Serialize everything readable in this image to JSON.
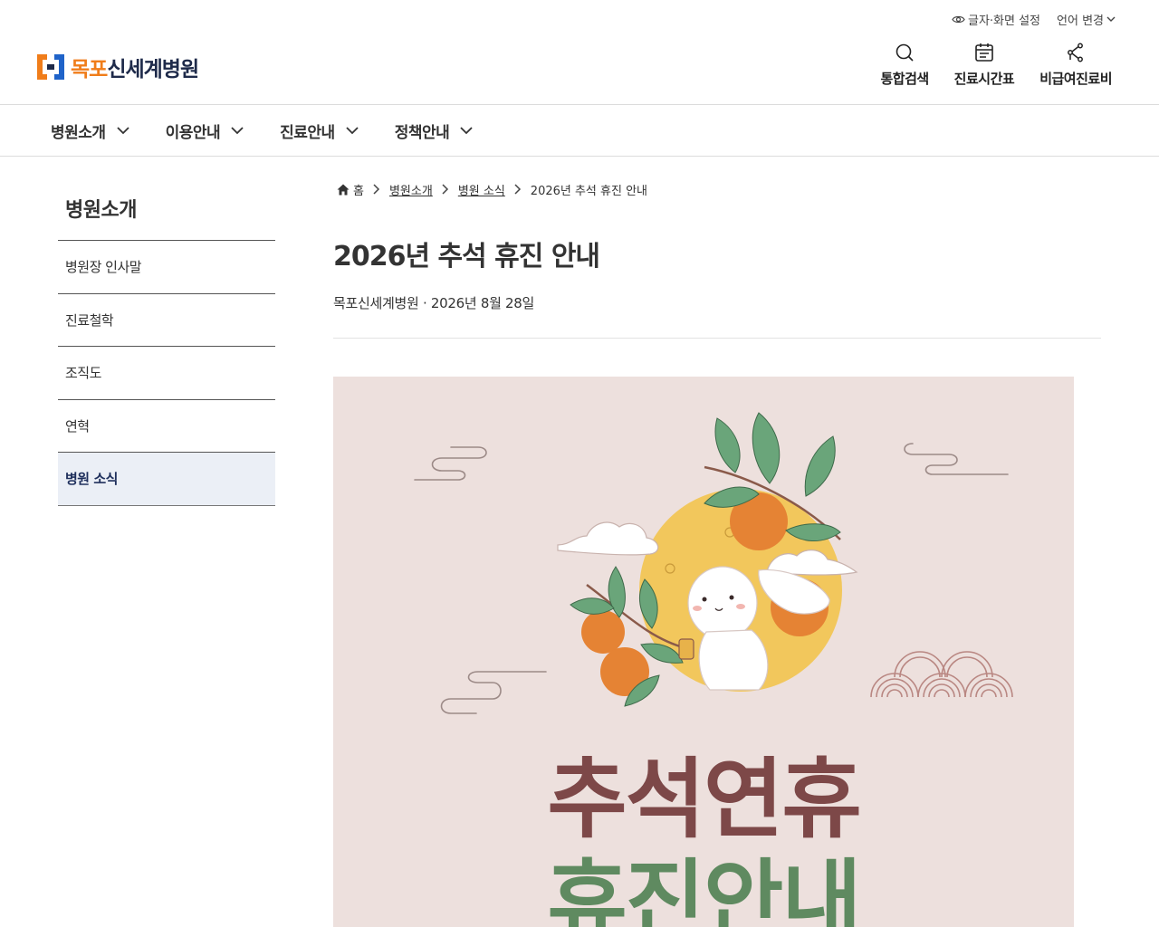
{
  "utility": {
    "font_setting": "글자·화면 설정",
    "language": "언어 변경"
  },
  "logo": {
    "part1": "목포",
    "part2": "신세계병원"
  },
  "quick_links": [
    {
      "label": "통합검색",
      "icon": "search-icon"
    },
    {
      "label": "진료시간표",
      "icon": "calendar-icon"
    },
    {
      "label": "비급여진료비",
      "icon": "route-icon"
    }
  ],
  "gnb": [
    {
      "label": "병원소개"
    },
    {
      "label": "이용안내"
    },
    {
      "label": "진료안내"
    },
    {
      "label": "정책안내"
    }
  ],
  "sidebar": {
    "title": "병원소개",
    "items": [
      {
        "label": "병원장 인사말"
      },
      {
        "label": "진료철학"
      },
      {
        "label": "조직도"
      },
      {
        "label": "연혁"
      },
      {
        "label": "병원 소식"
      }
    ],
    "active_index": 4
  },
  "breadcrumb": {
    "home": "홈",
    "items": [
      "병원소개",
      "병원 소식"
    ],
    "current": "2026년 추석 휴진 안내"
  },
  "article": {
    "title": "2026년 추석 휴진 안내",
    "meta": "목포신세계병원 · 2026년 8월 28일"
  },
  "poster": {
    "line1": "추석연휴",
    "line2": "휴진안내"
  },
  "colors": {
    "brand_orange": "#f07d1a",
    "brand_navy": "#1e2a4a",
    "brand_blue": "#1f63c9",
    "active_bg": "#ebeff6",
    "poster_bg": "#ede0dd",
    "poster_brown": "#7d4848",
    "poster_green": "#5f8a60"
  }
}
